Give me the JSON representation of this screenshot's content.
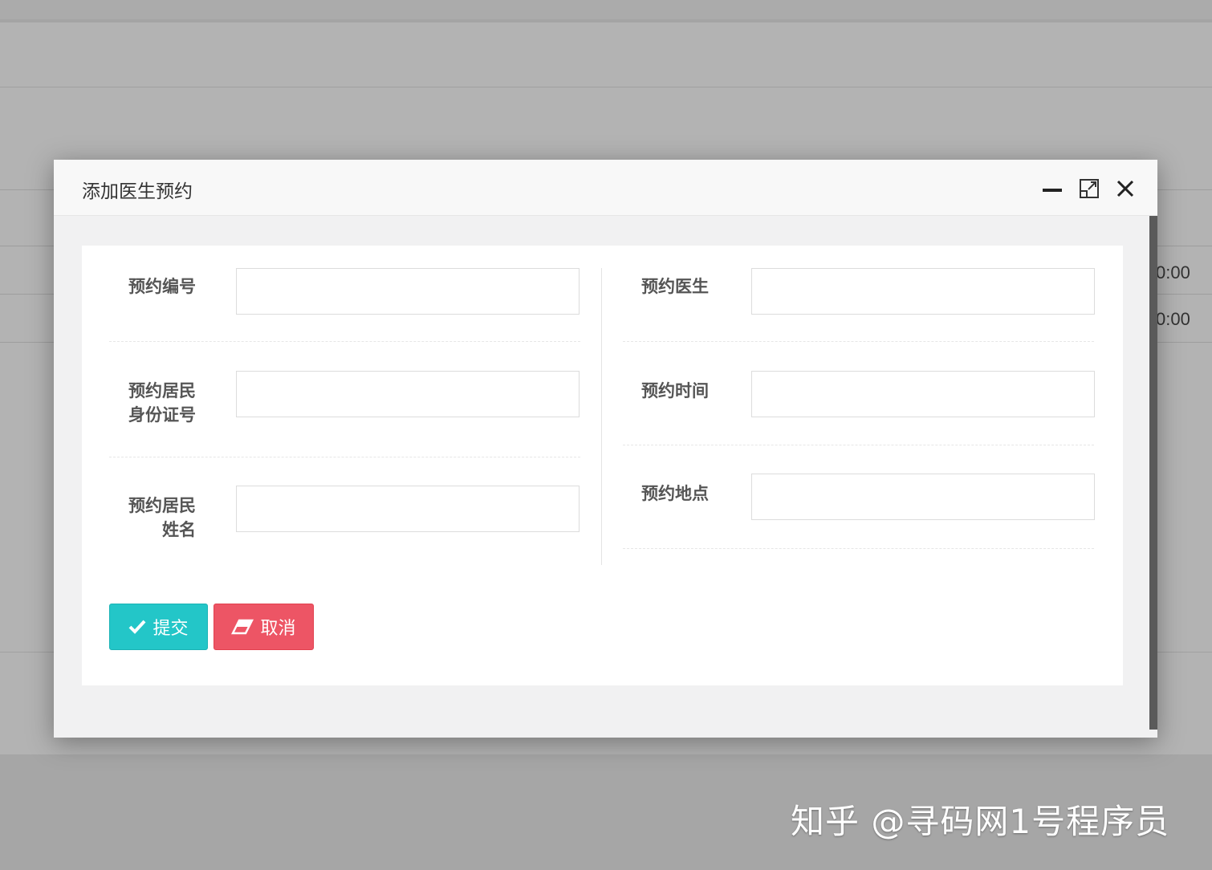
{
  "background": {
    "table_cells": [
      "0:00",
      "0:00"
    ]
  },
  "modal": {
    "title": "添加医生预约",
    "controls": {
      "minimize_icon": "minimize-icon",
      "maximize_icon": "maximize-icon",
      "close_icon": "close-icon"
    },
    "left_fields": [
      {
        "label_line1": "预约编号",
        "label_line2": "",
        "value": ""
      },
      {
        "label_line1": "预约居民",
        "label_line2": "身份证号",
        "value": ""
      },
      {
        "label_line1": "预约居民",
        "label_line2": "姓名",
        "value": ""
      }
    ],
    "right_fields": [
      {
        "label_line1": "预约医生",
        "label_line2": "",
        "value": ""
      },
      {
        "label_line1": "预约时间",
        "label_line2": "",
        "value": ""
      },
      {
        "label_line1": "预约地点",
        "label_line2": "",
        "value": ""
      }
    ],
    "buttons": {
      "submit_label": "提交",
      "cancel_label": "取消"
    }
  },
  "colors": {
    "submit": "#23c6c8",
    "cancel": "#ed5565"
  },
  "watermark": "知乎 @寻码网1号程序员"
}
